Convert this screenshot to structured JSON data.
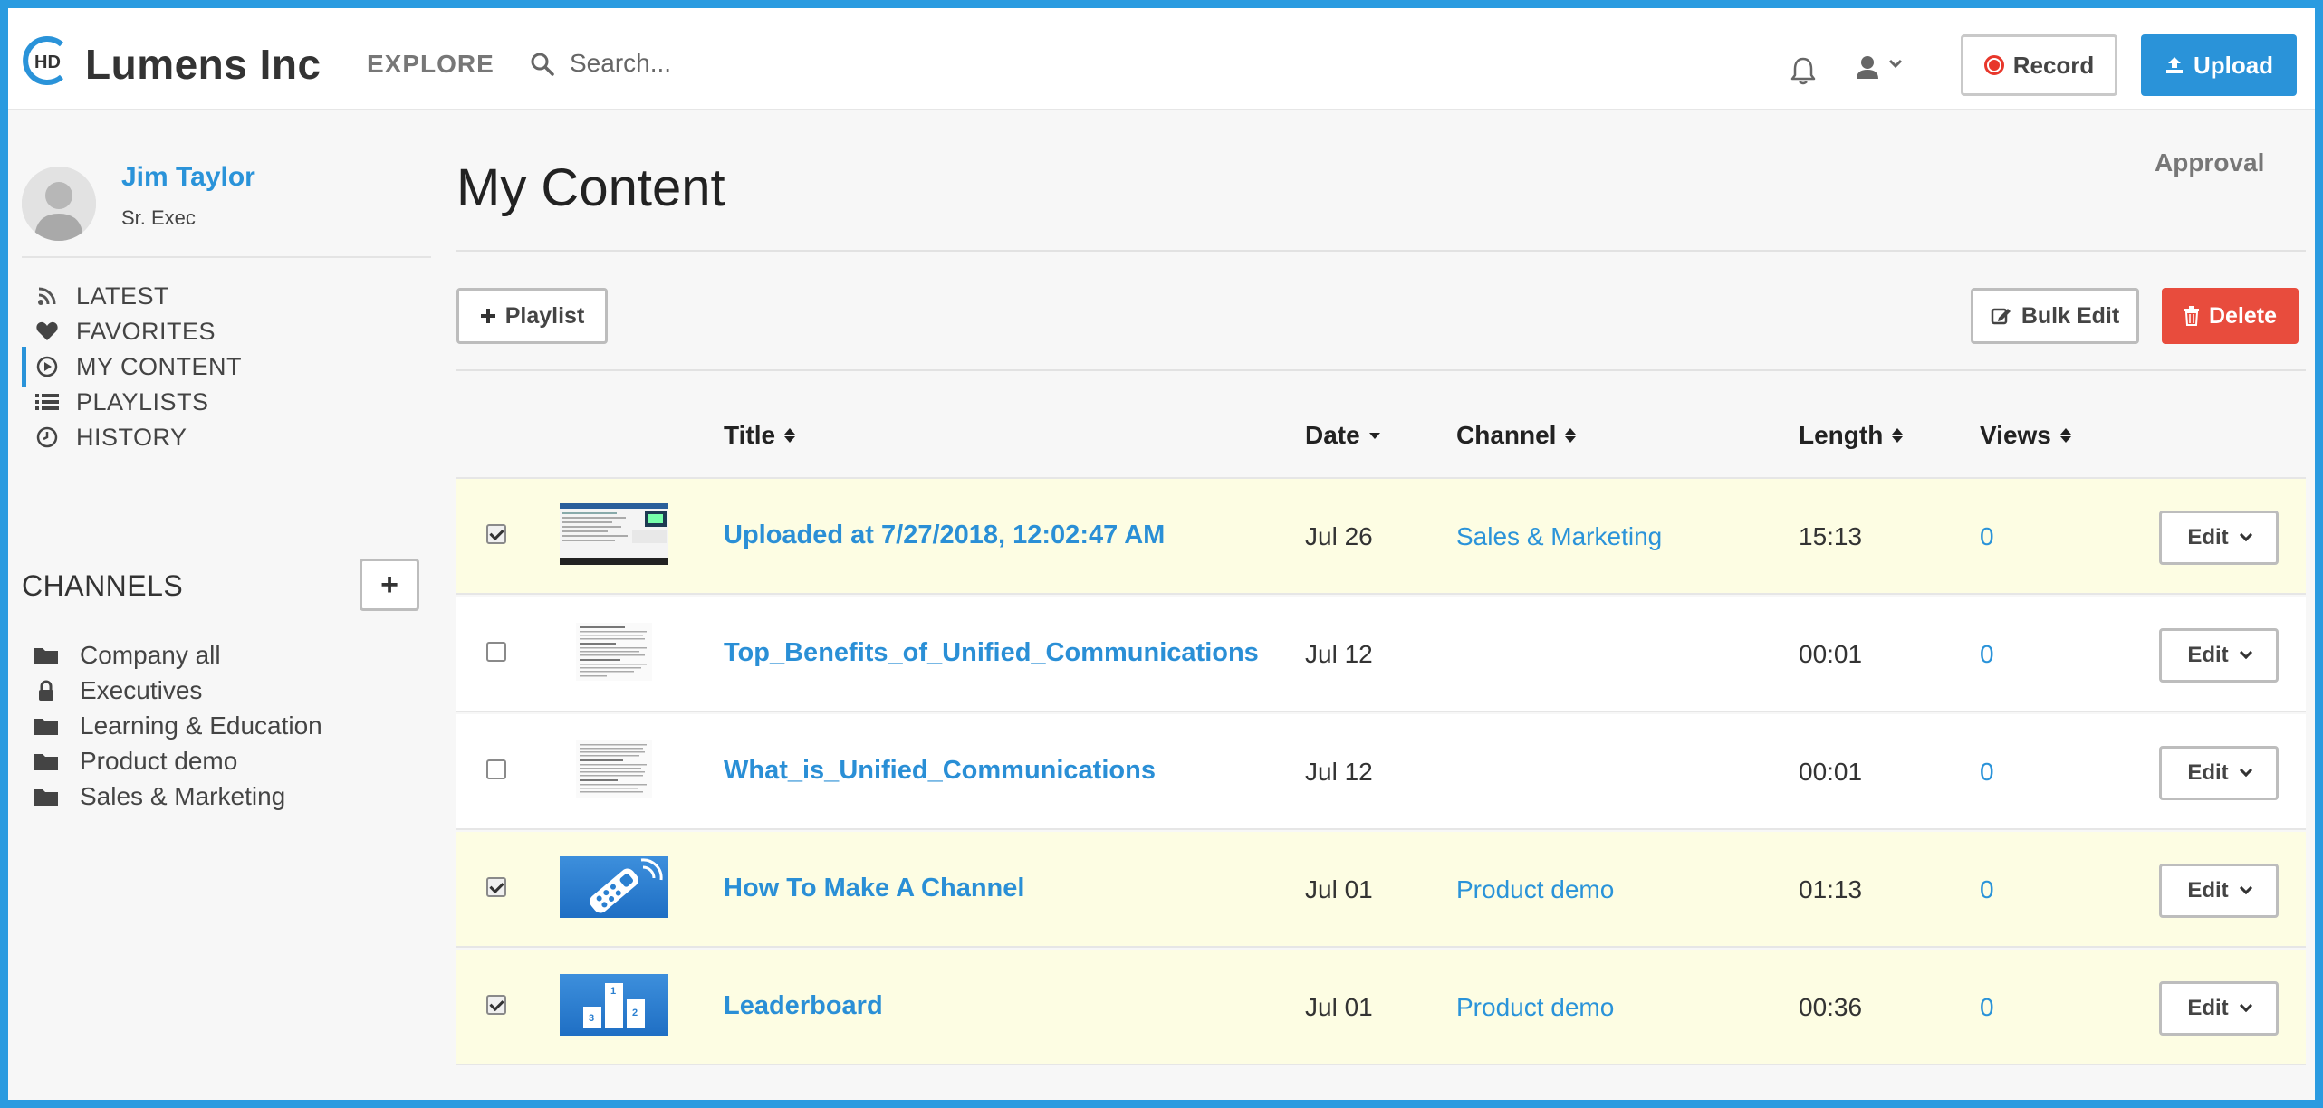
{
  "header": {
    "brand": "Lumens Inc",
    "logo_text": "HD",
    "explore": "EXPLORE",
    "search_placeholder": "Search...",
    "record_label": "Record",
    "upload_label": "Upload"
  },
  "user": {
    "name": "Jim Taylor",
    "role": "Sr. Exec"
  },
  "nav": [
    {
      "label": "LATEST",
      "icon": "rss-icon"
    },
    {
      "label": "FAVORITES",
      "icon": "heart-icon"
    },
    {
      "label": "MY CONTENT",
      "icon": "play-circle-icon",
      "active": true
    },
    {
      "label": "PLAYLISTS",
      "icon": "list-icon"
    },
    {
      "label": "HISTORY",
      "icon": "clock-icon"
    }
  ],
  "channels": {
    "title": "CHANNELS",
    "add_label": "+",
    "items": [
      {
        "label": "Company all",
        "icon": "folder-icon"
      },
      {
        "label": "Executives",
        "icon": "lock-icon"
      },
      {
        "label": "Learning & Education",
        "icon": "folder-icon"
      },
      {
        "label": "Product demo",
        "icon": "folder-icon"
      },
      {
        "label": "Sales & Marketing",
        "icon": "folder-icon"
      }
    ]
  },
  "main": {
    "title": "My Content",
    "approval": "Approval",
    "playlist_label": "Playlist",
    "bulk_edit_label": "Bulk Edit",
    "delete_label": "Delete",
    "columns": {
      "title": "Title",
      "date": "Date",
      "channel": "Channel",
      "length": "Length",
      "views": "Views"
    },
    "edit_label": "Edit",
    "rows": [
      {
        "title": "Uploaded at 7/27/2018, 12:02:47 AM",
        "date": "Jul 26",
        "channel": "Sales & Marketing",
        "length": "15:13",
        "views": "0",
        "checked": true,
        "thumb": "screen"
      },
      {
        "title": "Top_Benefits_of_Unified_Communications",
        "date": "Jul 12",
        "channel": "",
        "length": "00:01",
        "views": "0",
        "checked": false,
        "thumb": "doc"
      },
      {
        "title": "What_is_Unified_Communications",
        "date": "Jul 12",
        "channel": "",
        "length": "00:01",
        "views": "0",
        "checked": false,
        "thumb": "doc"
      },
      {
        "title": "How To Make A Channel",
        "date": "Jul 01",
        "channel": "Product demo",
        "length": "01:13",
        "views": "0",
        "checked": true,
        "thumb": "remote"
      },
      {
        "title": "Leaderboard",
        "date": "Jul 01",
        "channel": "Product demo",
        "length": "00:36",
        "views": "0",
        "checked": true,
        "thumb": "podium"
      }
    ]
  },
  "colors": {
    "accent": "#2a93d9",
    "delete": "#e84c3d",
    "selected_row": "#fdfde3",
    "frame": "#2a9be0"
  }
}
